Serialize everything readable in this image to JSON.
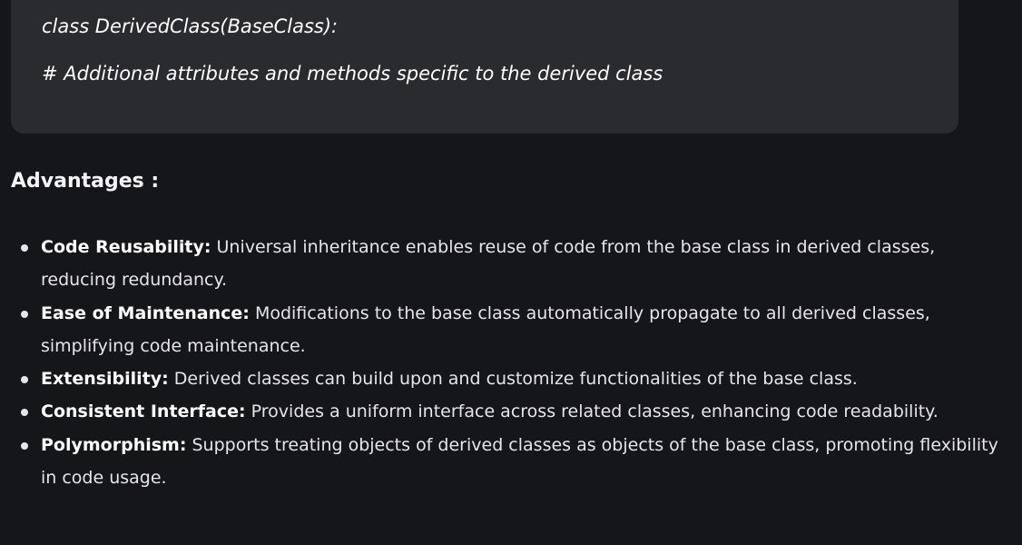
{
  "code": {
    "lines": [
      "class DerivedClass(BaseClass):",
      "# Additional attributes and methods specific to the derived class"
    ]
  },
  "advantages": {
    "title": "Advantages :",
    "items": [
      {
        "term": "Code Reusability:",
        "text": " Universal inheritance enables reuse of code from the base class in derived classes, reducing redundancy."
      },
      {
        "term": "Ease of Maintenance:",
        "text": " Modifications to the base class automatically propagate to all derived classes, simplifying code maintenance."
      },
      {
        "term": "Extensibility:",
        "text": " Derived classes can build upon and customize functionalities of the base class."
      },
      {
        "term": "Consistent Interface:",
        "text": " Provides a uniform interface across related classes, enhancing code readability."
      },
      {
        "term": "Polymorphism:",
        "text": " Supports treating objects of derived classes as objects of the base class, promoting flexibility in code usage."
      }
    ]
  }
}
